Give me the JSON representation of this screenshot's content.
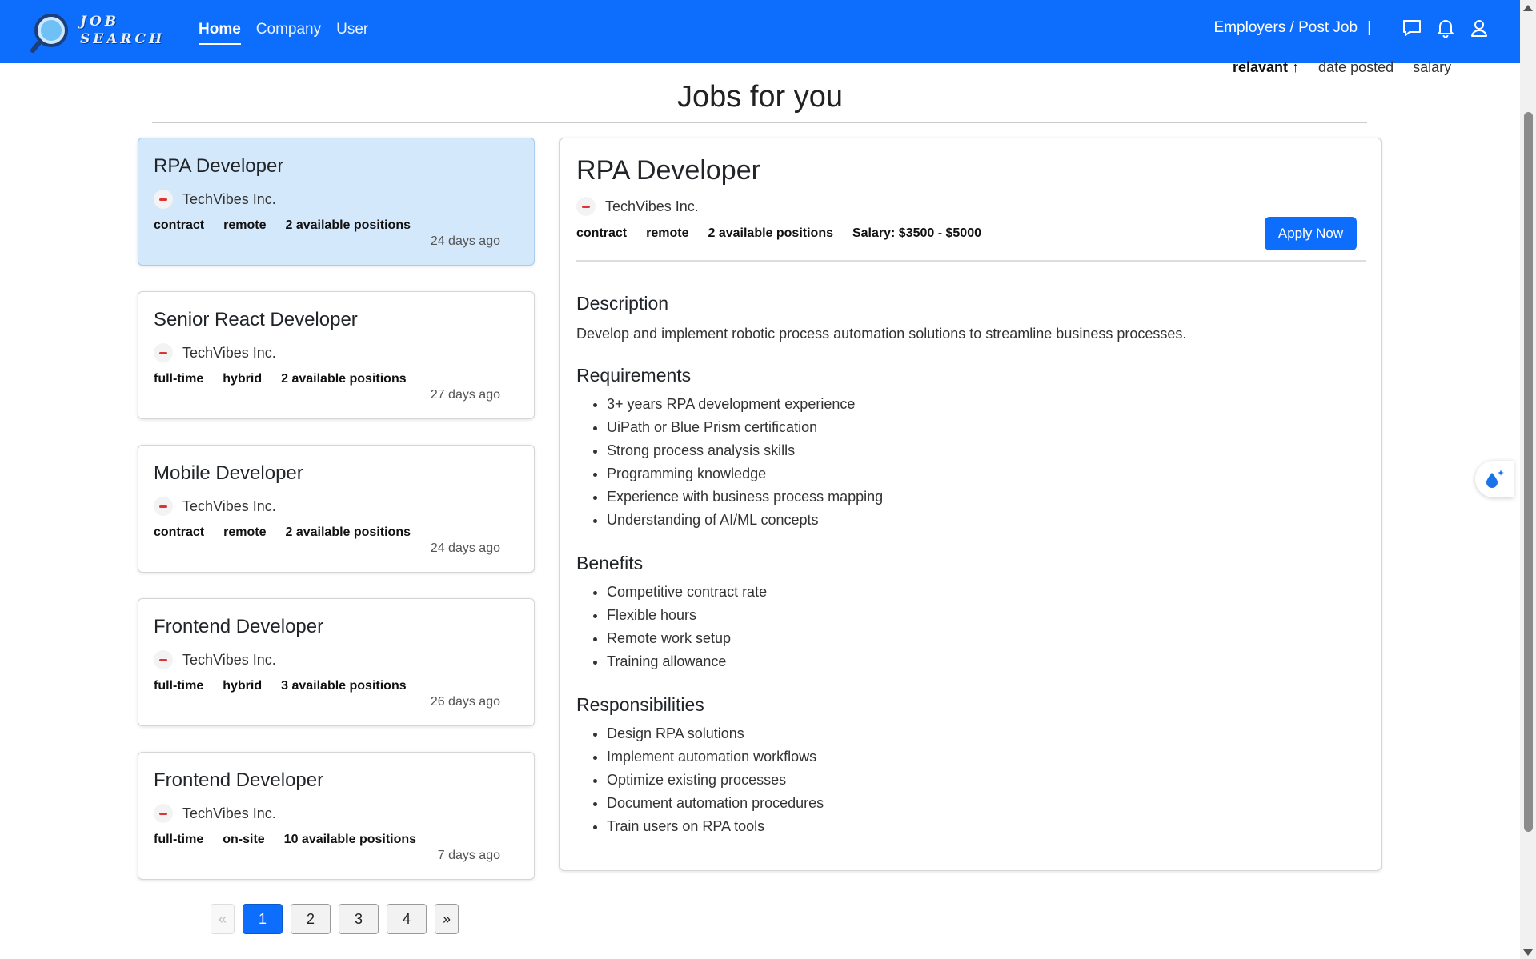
{
  "navbar": {
    "logo_line1": "JOB",
    "logo_line2": "SEARCH",
    "links": [
      "Home",
      "Company",
      "User"
    ],
    "active_link": "Home",
    "employers_label": "Employers / Post Job",
    "separator": "|",
    "icons": [
      "chat-icon",
      "bell-icon",
      "user-icon"
    ]
  },
  "sort": {
    "options": [
      "relavant ↑",
      "date posted",
      "salary"
    ],
    "active": "relavant ↑"
  },
  "page_title": "Jobs for you",
  "jobs": [
    {
      "title": "RPA Developer",
      "company": "TechVibes Inc.",
      "tags": [
        "contract",
        "remote",
        "2 available positions"
      ],
      "posted": "24 days ago",
      "selected": true
    },
    {
      "title": "Senior React Developer",
      "company": "TechVibes Inc.",
      "tags": [
        "full-time",
        "hybrid",
        "2 available positions"
      ],
      "posted": "27 days ago",
      "selected": false
    },
    {
      "title": "Mobile Developer",
      "company": "TechVibes Inc.",
      "tags": [
        "contract",
        "remote",
        "2 available positions"
      ],
      "posted": "24 days ago",
      "selected": false
    },
    {
      "title": "Frontend Developer",
      "company": "TechVibes Inc.",
      "tags": [
        "full-time",
        "hybrid",
        "3 available positions"
      ],
      "posted": "26 days ago",
      "selected": false
    },
    {
      "title": "Frontend Developer",
      "company": "TechVibes Inc.",
      "tags": [
        "full-time",
        "on-site",
        "10 available positions"
      ],
      "posted": "7 days ago",
      "selected": false
    }
  ],
  "pagination": {
    "prev": "«",
    "pages": [
      "1",
      "2",
      "3",
      "4"
    ],
    "active": "1",
    "next": "»"
  },
  "detail": {
    "title": "RPA Developer",
    "company": "TechVibes Inc.",
    "tags": [
      "contract",
      "remote",
      "2 available positions",
      "Salary: $3500 - $5000"
    ],
    "apply_label": "Apply Now",
    "description_heading": "Description",
    "description": "Develop and implement robotic process automation solutions to streamline business processes.",
    "requirements_heading": "Requirements",
    "requirements": [
      "3+ years RPA development experience",
      "UiPath or Blue Prism certification",
      "Strong process analysis skills",
      "Programming knowledge",
      "Experience with business process mapping",
      "Understanding of AI/ML concepts"
    ],
    "benefits_heading": "Benefits",
    "benefits": [
      "Competitive contract rate",
      "Flexible hours",
      "Remote work setup",
      "Training allowance"
    ],
    "responsibilities_heading": "Responsibilities",
    "responsibilities": [
      "Design RPA solutions",
      "Implement automation workflows",
      "Optimize existing processes",
      "Document automation procedures",
      "Train users on RPA tools"
    ]
  },
  "colors": {
    "brand": "#0d6efd",
    "selected_card": "#d4e8fb"
  }
}
